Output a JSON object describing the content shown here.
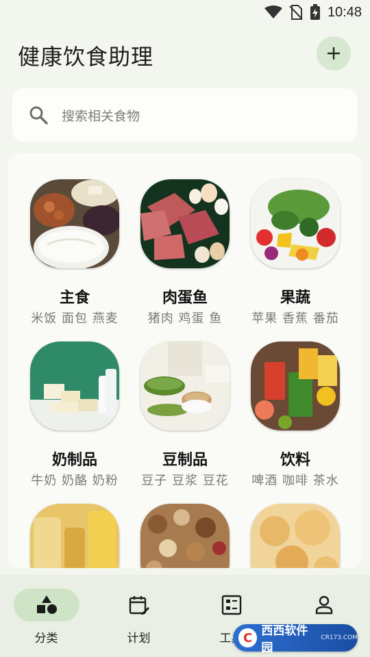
{
  "status_bar": {
    "time": "10:48"
  },
  "header": {
    "title": "健康饮食助理",
    "add_icon": "plus-icon"
  },
  "search": {
    "placeholder": "搜索相关食物",
    "icon": "search-icon"
  },
  "categories": [
    {
      "name": "主食",
      "sub": "米饭 面包 燕麦",
      "image": "staple-food-photo"
    },
    {
      "name": "肉蛋鱼",
      "sub": "猪肉 鸡蛋 鱼",
      "image": "meat-egg-fish-photo"
    },
    {
      "name": "果蔬",
      "sub": "苹果 香蕉 番茄",
      "image": "fruits-vegetables-photo"
    },
    {
      "name": "奶制品",
      "sub": "牛奶 奶酪 奶粉",
      "image": "dairy-photo"
    },
    {
      "name": "豆制品",
      "sub": "豆子 豆浆 豆花",
      "image": "soy-products-photo"
    },
    {
      "name": "饮料",
      "sub": "啤酒 咖啡 茶水",
      "image": "drinks-photo"
    },
    {
      "name": "",
      "sub": "",
      "image": "oils-photo"
    },
    {
      "name": "",
      "sub": "",
      "image": "nuts-photo"
    },
    {
      "name": "",
      "sub": "",
      "image": "snacks-photo"
    }
  ],
  "nav": [
    {
      "label": "分类",
      "icon": "category-shapes-icon",
      "active": true
    },
    {
      "label": "计划",
      "icon": "calendar-edit-icon",
      "active": false
    },
    {
      "label": "工具",
      "icon": "tools-grid-icon",
      "active": false
    },
    {
      "label": "",
      "icon": "person-icon",
      "active": false
    }
  ],
  "watermark": {
    "brand": "西西软件园",
    "site": "CR173.COM"
  },
  "colors": {
    "background": "#f2f6ee",
    "accent_light": "#d6e8cf",
    "nav_active": "#cfe3c6",
    "card": "#fafbf7"
  }
}
